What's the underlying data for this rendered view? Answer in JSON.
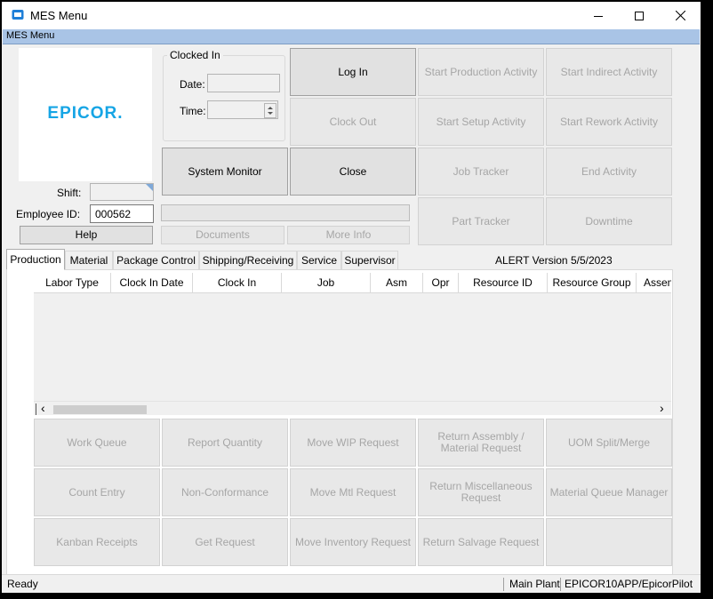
{
  "window": {
    "title": "MES Menu",
    "minimize_glyph": "—",
    "maximize_glyph": "☐",
    "close_glyph": "✕",
    "icon": "mes-app-icon"
  },
  "menubar": {
    "label": "MES Menu"
  },
  "logo": {
    "text": "EPICOR",
    "trademark": "."
  },
  "clock": {
    "group_title": "Clocked In",
    "date_label": "Date:",
    "date_value": "",
    "time_label": "Time:",
    "time_value": ""
  },
  "employee": {
    "shift_label": "Shift:",
    "shift_value": "",
    "id_label": "Employee ID:",
    "id_value": "000562"
  },
  "buttons": {
    "help": "Help",
    "documents": "Documents",
    "more_info": "More Info",
    "system_monitor": "System Monitor",
    "log_in": "Log In",
    "clock_out": "Clock Out",
    "close": "Close",
    "start_production": "Start Production Activity",
    "start_setup": "Start Setup Activity",
    "job_tracker": "Job Tracker",
    "part_tracker": "Part Tracker",
    "start_indirect": "Start Indirect Activity",
    "start_rework": "Start Rework Activity",
    "end_activity": "End Activity",
    "downtime": "Downtime"
  },
  "tabs": [
    "Production",
    "Material",
    "Package Control",
    "Shipping/Receiving",
    "Service",
    "Supervisor"
  ],
  "alert_text": "ALERT Version 5/5/2023",
  "grid": {
    "columns": [
      "Labor Type",
      "Clock In Date",
      "Clock In",
      "Job",
      "Asm",
      "Opr",
      "Resource ID",
      "Resource Group",
      "Assem"
    ],
    "rows": []
  },
  "scroll": {
    "left_glyph": "‹",
    "right_glyph": "›"
  },
  "actions": [
    [
      "Work Queue",
      "Report Quantity",
      "Move WIP Request",
      "Return Assembly / Material Request",
      "UOM Split/Merge"
    ],
    [
      "Count Entry",
      "Non-Conformance",
      "Move Mtl Request",
      "Return Miscellaneous Request",
      "Material Queue Manager"
    ],
    [
      "Kanban Receipts",
      "Get Request",
      "Move Inventory Request",
      "Return Salvage Request",
      ""
    ]
  ],
  "status": {
    "left": "Ready",
    "plant": "Main Plant",
    "server": "EPICOR10APP/EpicorPilot"
  }
}
